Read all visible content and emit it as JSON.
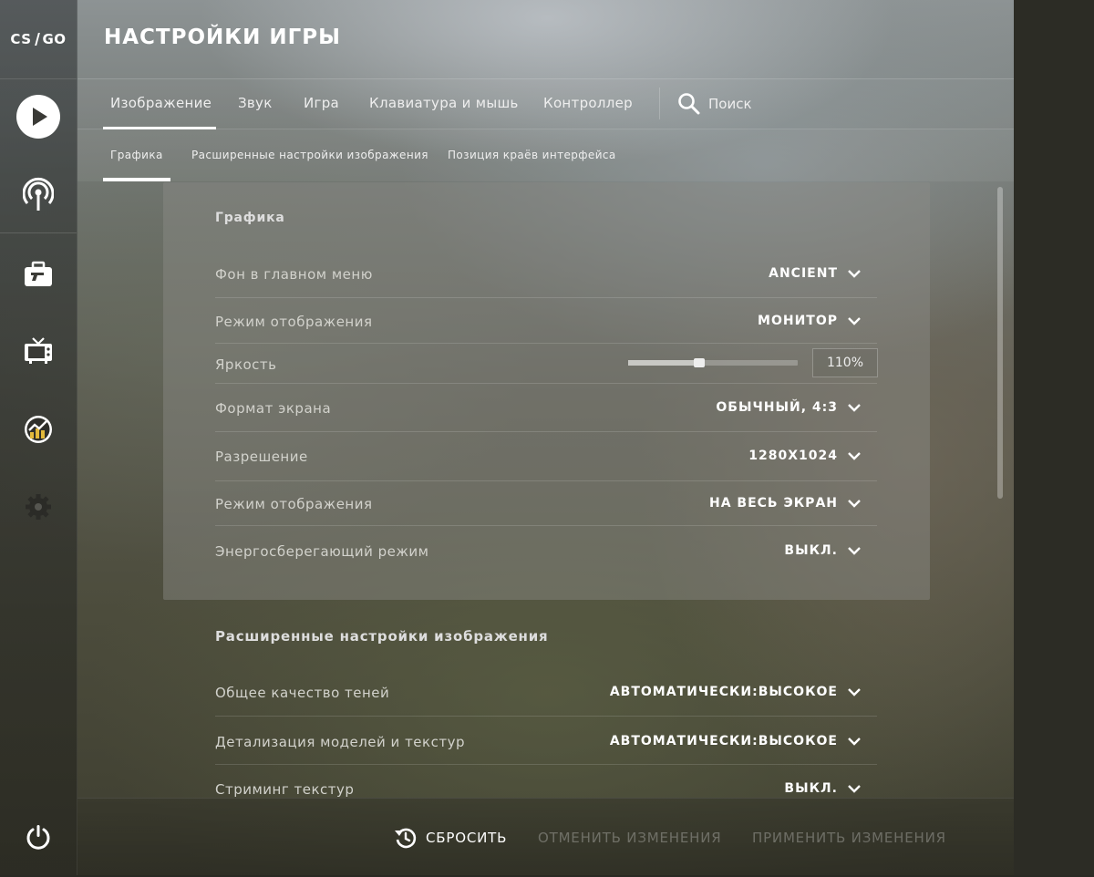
{
  "app": {
    "logo_left": "CS",
    "logo_right": "GO"
  },
  "nav": {
    "icons": [
      "play-icon",
      "broadcast-icon",
      "inventory-icon",
      "tv-icon",
      "stats-icon",
      "gear-icon",
      "power-icon"
    ]
  },
  "header": {
    "title": "НАСТРОЙКИ ИГРЫ"
  },
  "tabs": [
    {
      "label": "Изображение",
      "active": true
    },
    {
      "label": "Звук"
    },
    {
      "label": "Игра"
    },
    {
      "label": "Клавиатура и мышь"
    },
    {
      "label": "Контроллер"
    }
  ],
  "search": {
    "label": "Поиск"
  },
  "subtabs": [
    {
      "label": "Графика",
      "active": true
    },
    {
      "label": "Расширенные настройки изображения"
    },
    {
      "label": "Позиция краёв интерфейса"
    }
  ],
  "graphics": {
    "title": "Графика",
    "rows": [
      {
        "label": "Фон в главном меню",
        "value": "ANCIENT"
      },
      {
        "label": "Режим отображения",
        "value": "МОНИТОР"
      },
      {
        "label": "Яркость",
        "value": "110%",
        "slider_fraction": 0.42
      },
      {
        "label": "Формат экрана",
        "value": "ОБЫЧНЫЙ, 4:3"
      },
      {
        "label": "Разрешение",
        "value": "1280X1024"
      },
      {
        "label": "Режим отображения",
        "value": "НА ВЕСЬ ЭКРАН"
      },
      {
        "label": "Энергосберегающий режим",
        "value": "ВЫКЛ."
      }
    ]
  },
  "advanced": {
    "title": "Расширенные настройки изображения",
    "rows": [
      {
        "label": "Общее качество теней",
        "value": "АВТОМАТИЧЕСКИ:ВЫСОКОЕ"
      },
      {
        "label": "Детализация моделей и текстур",
        "value": "АВТОМАТИЧЕСКИ:ВЫСОКОЕ"
      },
      {
        "label": "Стриминг текстур",
        "value": "ВЫКЛ."
      }
    ]
  },
  "footer": {
    "reset": "СБРОСИТЬ",
    "cancel": "ОТМЕНИТЬ ИЗМЕНЕНИЯ",
    "apply": "ПРИМЕНИТЬ ИЗМЕНЕНИЯ"
  }
}
